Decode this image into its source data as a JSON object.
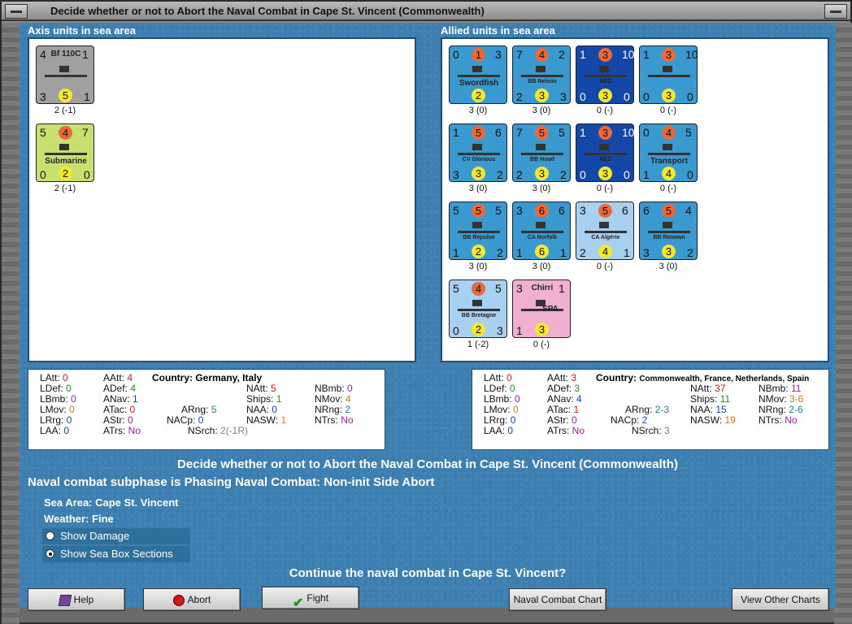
{
  "window": {
    "title": "Decide whether or not to Abort the Naval Combat in Cape St. Vincent (Commonwealth)"
  },
  "axis": {
    "heading": "Axis units in sea area",
    "units": [
      {
        "name": "Bf 110C",
        "tl": "4",
        "tr": "1",
        "bl": "3",
        "bm": "5",
        "br": "1",
        "label": "2 (-1)",
        "color": "#a0a0a0"
      },
      {
        "name": "Submarine",
        "tl": "5",
        "tm": "4",
        "tr": "7",
        "bl": "0",
        "bm": "2",
        "br": "0",
        "label": "2 (-1)",
        "color": "#c8e070"
      }
    ]
  },
  "allied": {
    "heading": "Allied units in sea area",
    "units": [
      {
        "name": "Swordfish",
        "tl": "0",
        "tm": "1",
        "tr": "3",
        "bm": "2",
        "label": "3 (0)",
        "color": "#3a9ad0"
      },
      {
        "name": "BB Nelson",
        "tl": "7",
        "tm": "4",
        "tr": "2",
        "bl": "2",
        "bm": "3",
        "br": "3",
        "label": "3 (0)",
        "color": "#3a9ad0"
      },
      {
        "name": "NED",
        "tl": "1",
        "tm": "3",
        "tr": "10",
        "bl": "0",
        "bm": "3",
        "br": "0",
        "label": "0 (-)",
        "color": "#1448a8"
      },
      {
        "name": "",
        "tl": "1",
        "tm": "3",
        "tr": "10",
        "bl": "0",
        "bm": "3",
        "br": "0",
        "label": "0 (-)",
        "color": "#3a9ad0"
      },
      {
        "name": "CV Glorious",
        "tl": "1",
        "tm": "5",
        "tr": "6",
        "bl": "3",
        "bm": "3",
        "br": "2",
        "label": "3 (0)",
        "color": "#3a9ad0"
      },
      {
        "name": "BB Hood",
        "tl": "7",
        "tm": "5",
        "tr": "5",
        "bl": "2",
        "bm": "3",
        "br": "2",
        "label": "3 (0)",
        "color": "#3a9ad0"
      },
      {
        "name": "NED",
        "tl": "1",
        "tm": "3",
        "tr": "10",
        "bl": "0",
        "bm": "3",
        "br": "0",
        "label": "0 (-)",
        "color": "#1448a8"
      },
      {
        "name": "Transport",
        "tl": "0",
        "tm": "4",
        "tr": "5",
        "bl": "1",
        "bm": "4",
        "br": "0",
        "label": "0 (-)",
        "color": "#3a9ad0"
      },
      {
        "name": "BB Repulse",
        "tl": "5",
        "tm": "5",
        "tr": "5",
        "bl": "1",
        "bm": "2",
        "br": "2",
        "label": "3 (0)",
        "color": "#3a9ad0"
      },
      {
        "name": "CA Norfolk",
        "tl": "3",
        "tm": "6",
        "tr": "6",
        "bl": "1",
        "bm": "6",
        "br": "1",
        "label": "3 (0)",
        "color": "#3a9ad0"
      },
      {
        "name": "CA Algérie",
        "tl": "3",
        "tm": "5",
        "tr": "6",
        "bl": "2",
        "bm": "4",
        "br": "1",
        "label": "0 (-)",
        "color": "#a8d0f0"
      },
      {
        "name": "BB Renown",
        "tl": "6",
        "tm": "5",
        "tr": "4",
        "bl": "3",
        "bm": "3",
        "br": "2",
        "label": "3 (0)",
        "color": "#3a9ad0"
      },
      {
        "name": "BB Bretagne",
        "tl": "5",
        "tm": "4",
        "tr": "5",
        "bl": "0",
        "bm": "2",
        "br": "3",
        "label": "1 (-2)",
        "color": "#a8d0f0"
      },
      {
        "name": "Chirri",
        "sub": "SPA",
        "tl": "3",
        "tr": "1",
        "bl": "1",
        "bm": "3",
        "label": "0 (-)",
        "color": "#f0b0d0"
      }
    ]
  },
  "axis_stats": {
    "country_label": "Country:",
    "country": "Germany, Italy",
    "LAtt": "0",
    "LDef": "0",
    "LBmb": "0",
    "LMov": "0",
    "LRrg": "0",
    "LAA": "0",
    "AAtt": "4",
    "ADef": "4",
    "ANav": "1",
    "ATac": "0",
    "AStr": "0",
    "ATrs": "No",
    "ARng": "5",
    "NACp": "0",
    "NAtt": "5",
    "Ships": "1",
    "NAA": "0",
    "NASW": "1",
    "NBmb": "0",
    "NMov": "4",
    "NRng": "2",
    "NTrs": "No",
    "NSrch": "2(-1R)"
  },
  "allied_stats": {
    "country_label": "Country:",
    "country": "Commonwealth, France, Netherlands, Spain",
    "LAtt": "0",
    "LDef": "0",
    "LBmb": "0",
    "LMov": "0",
    "LRrg": "0",
    "LAA": "0",
    "AAtt": "3",
    "ADef": "3",
    "ANav": "4",
    "ATac": "1",
    "AStr": "0",
    "ATrs": "No",
    "ARng": "2-3",
    "NACp": "2",
    "NAtt": "37",
    "Ships": "11",
    "NAA": "15",
    "NASW": "19",
    "NBmb": "11",
    "NMov": "3-6",
    "NRng": "2-6",
    "NTrs": "No",
    "NSrch": "3"
  },
  "messages": {
    "main": "Decide whether or not to Abort the Naval Combat in Cape St. Vincent (Commonwealth)",
    "subphase": "Naval combat subphase is Phasing Naval Combat: Non-init Side Abort",
    "sea_area_label": "Sea Area:",
    "sea_area": "Cape St. Vincent",
    "weather_label": "Weather:",
    "weather": "Fine",
    "question": "Continue the naval combat in Cape St. Vincent?"
  },
  "options": {
    "show_damage": "Show Damage",
    "show_sea_box": "Show Sea Box Sections"
  },
  "buttons": {
    "help": "Help",
    "abort": "Abort",
    "fight": "Fight",
    "naval_chart": "Naval Combat Chart",
    "other_charts": "View Other Charts"
  },
  "colors": {
    "panel": "#3c7fb0",
    "orange": "#e86a3a",
    "yellow": "#f5e82a"
  }
}
